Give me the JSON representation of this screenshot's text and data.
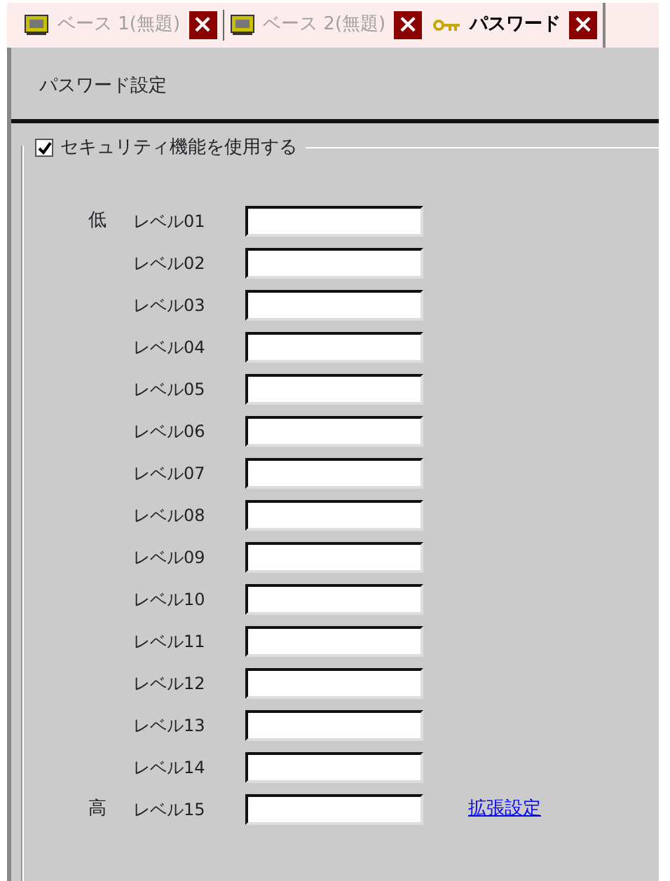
{
  "tabs": [
    {
      "kind": "base",
      "label": "ベース 1(無題)",
      "selected": false,
      "close": "×"
    },
    {
      "kind": "base",
      "label": "ベース 2(無題)",
      "selected": false,
      "close": "×"
    },
    {
      "kind": "password",
      "label": "パスワード",
      "selected": true,
      "close": "×"
    }
  ],
  "header": {
    "title": "パスワード設定"
  },
  "security": {
    "label": "セキュリティ機能を使用する",
    "checked": true
  },
  "levels": [
    {
      "marker": "低",
      "label": "レベル01"
    },
    {
      "label": "レベル02"
    },
    {
      "label": "レベル03"
    },
    {
      "label": "レベル04"
    },
    {
      "label": "レベル05"
    },
    {
      "label": "レベル06"
    },
    {
      "label": "レベル07"
    },
    {
      "label": "レベル08"
    },
    {
      "label": "レベル09"
    },
    {
      "label": "レベル10"
    },
    {
      "label": "レベル11"
    },
    {
      "label": "レベル12"
    },
    {
      "label": "レベル13"
    },
    {
      "label": "レベル14"
    },
    {
      "marker": "高",
      "label": "レベル15",
      "link": "拡張設定"
    }
  ]
}
